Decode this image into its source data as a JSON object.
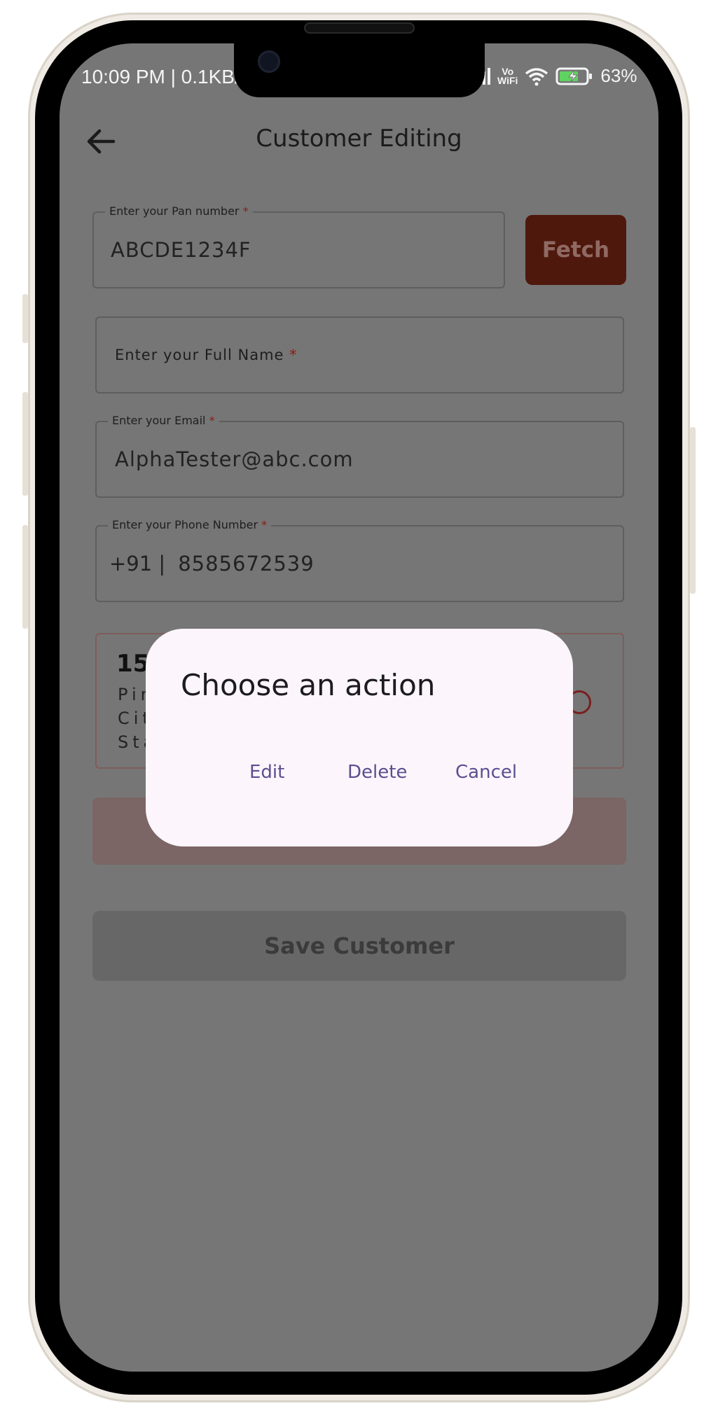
{
  "status_bar": {
    "time": "10:09 PM | 0.1KB/",
    "vowifi_top": "Vo",
    "vowifi_bottom": "WiFi",
    "battery": "63%"
  },
  "app_bar": {
    "title": "Customer Editing",
    "back_icon": "arrow-left-icon"
  },
  "form": {
    "pan": {
      "label": "Enter your Pan number",
      "required_mark": "*",
      "value": "ABCDE1234F"
    },
    "fetch_label": "Fetch",
    "full_name": {
      "placeholder": "Enter your Full Name",
      "required_mark": "*"
    },
    "email": {
      "label": "Enter your Email",
      "required_mark": "*",
      "value": "AlphaTester@abc.com"
    },
    "phone": {
      "label": "Enter your Phone Number",
      "required_mark": "*",
      "prefix": "+91 |",
      "value": "8585672539"
    }
  },
  "address_card": {
    "number": "15",
    "line1": "Pin",
    "line2": "Cit",
    "line3": "Sta"
  },
  "save_label": "Save Customer",
  "dialog": {
    "title": "Choose an action",
    "actions": [
      "Edit",
      "Delete",
      "Cancel"
    ]
  }
}
